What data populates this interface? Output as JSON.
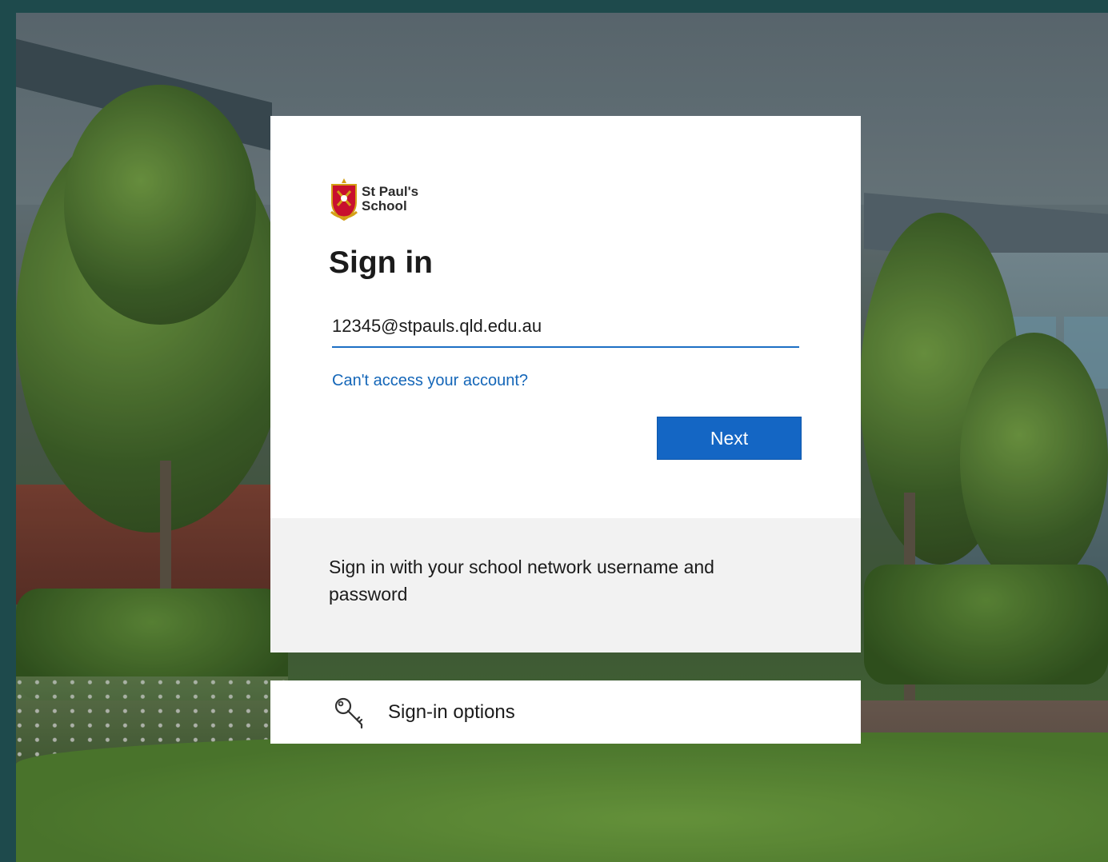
{
  "brand": {
    "logo_line1": "St Paul's",
    "logo_line2": "School",
    "crest_icon": "school-crest-icon",
    "crest_colors": [
      "#c8102e",
      "#d4a017"
    ]
  },
  "signin": {
    "title": "Sign in",
    "email_value": "12345@stpauls.qld.edu.au",
    "help_link": "Can't access your account?",
    "next_label": "Next"
  },
  "footer": {
    "message": "Sign in with your school network username and password"
  },
  "options": {
    "icon": "key-icon",
    "label": "Sign-in options"
  },
  "colors": {
    "accent": "#1466c4",
    "link": "#1466b8",
    "frame": "#1e4a4c",
    "footer_bg": "#f2f2f2"
  }
}
